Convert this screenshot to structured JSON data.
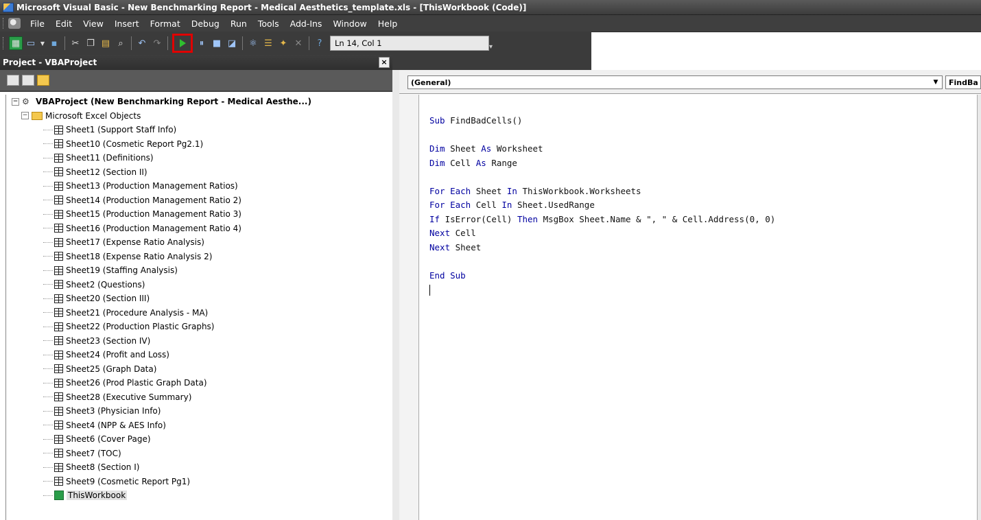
{
  "window": {
    "title": "Microsoft Visual Basic - New Benchmarking Report - Medical Aesthetics_template.xls - [ThisWorkbook (Code)]"
  },
  "menu": [
    "File",
    "Edit",
    "View",
    "Insert",
    "Format",
    "Debug",
    "Run",
    "Tools",
    "Add-Ins",
    "Window",
    "Help"
  ],
  "toolbar": {
    "position_label": "Ln 14, Col 1",
    "highlight_color": "#e00000"
  },
  "project": {
    "header": "Project - VBAProject",
    "close": "×",
    "root": "VBAProject (New Benchmarking Report - Medical Aesthe...)",
    "folder": "Microsoft Excel Objects",
    "items": [
      "Sheet1 (Support Staff Info)",
      "Sheet10 (Cosmetic Report Pg2.1)",
      "Sheet11 (Definitions)",
      "Sheet12 (Section II)",
      "Sheet13 (Production Management Ratios)",
      "Sheet14 (Production Management Ratio 2)",
      "Sheet15 (Production Management Ratio 3)",
      "Sheet16 (Production Management Ratio 4)",
      "Sheet17 (Expense Ratio Analysis)",
      "Sheet18 (Expense Ratio Analysis 2)",
      "Sheet19 (Staffing Analysis)",
      "Sheet2 (Questions)",
      "Sheet20 (Section III)",
      "Sheet21 (Procedure Analysis - MA)",
      "Sheet22 (Production Plastic Graphs)",
      "Sheet23 (Section IV)",
      "Sheet24 (Profit and Loss)",
      "Sheet25 (Graph Data)",
      "Sheet26 (Prod Plastic Graph Data)",
      "Sheet28 (Executive Summary)",
      "Sheet3 (Physician Info)",
      "Sheet4 (NPP & AES Info)",
      "Sheet6 (Cover Page)",
      "Sheet7 (TOC)",
      "Sheet8 (Section I)",
      "Sheet9 (Cosmetic Report Pg1)"
    ],
    "workbook": "ThisWorkbook"
  },
  "code": {
    "object_combo": "(General)",
    "proc_combo": "FindBa",
    "lines": [
      {
        "kw": "Sub",
        "rest": " FindBadCells()"
      },
      {
        "kw": "",
        "rest": ""
      },
      {
        "kw": "Dim",
        "rest": " Sheet ",
        "kw2": "As",
        "rest2": " Worksheet"
      },
      {
        "kw": "Dim",
        "rest": " Cell ",
        "kw2": "As",
        "rest2": " Range"
      },
      {
        "kw": "",
        "rest": ""
      },
      {
        "kw": "For Each",
        "rest": " Sheet ",
        "kw2": "In",
        "rest2": " ThisWorkbook.Worksheets"
      },
      {
        "kw": "For Each",
        "rest": " Cell ",
        "kw2": "In",
        "rest2": " Sheet.UsedRange"
      },
      {
        "kw": "If",
        "rest": " IsError(Cell) ",
        "kw2": "Then",
        "rest2": " MsgBox Sheet.Name & \", \" & Cell.Address(0, 0)"
      },
      {
        "kw": "Next",
        "rest": " Cell"
      },
      {
        "kw": "Next",
        "rest": " Sheet"
      },
      {
        "kw": "",
        "rest": ""
      },
      {
        "kw": "End Sub",
        "rest": ""
      }
    ]
  }
}
